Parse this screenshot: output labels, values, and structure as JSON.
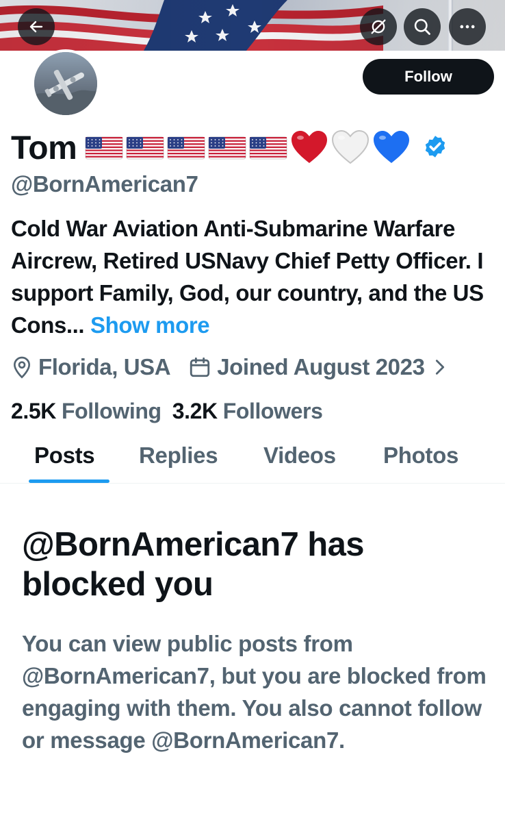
{
  "header": {
    "back_icon": "arrow-left-icon",
    "hide_icon": "eye-slash-icon",
    "search_icon": "search-icon",
    "more_icon": "more-horizontal-icon"
  },
  "profile": {
    "follow_label": "Follow",
    "display_name": "Tom",
    "name_emojis": [
      "🇺🇸",
      "🇺🇸",
      "🇺🇸",
      "🇺🇸",
      "🇺🇸",
      "❤️",
      "🤍",
      "💙"
    ],
    "handle": "@BornAmerican7",
    "bio": "Cold War Aviation Anti-Submarine Warfare Aircrew, Retired USNavy Chief Petty Officer. I support Family, God, our country, and the US Cons...",
    "show_more": "Show more",
    "location": "Florida, USA",
    "joined": "Joined August 2023",
    "following_count": "2.5K",
    "following_label": "Following",
    "followers_count": "3.2K",
    "followers_label": "Followers"
  },
  "tabs": [
    {
      "label": "Posts",
      "active": true
    },
    {
      "label": "Replies",
      "active": false
    },
    {
      "label": "Videos",
      "active": false
    },
    {
      "label": "Photos",
      "active": false
    }
  ],
  "blocked": {
    "title": "@BornAmerican7 has blocked you",
    "description": "You can view public posts from @BornAmerican7, but you are blocked from engaging with them. You also cannot follow or message @BornAmerican7."
  },
  "colors": {
    "accent": "#1d9bf0",
    "text_primary": "#0f1419",
    "text_secondary": "#536471",
    "verified": "#1d9bf0"
  }
}
